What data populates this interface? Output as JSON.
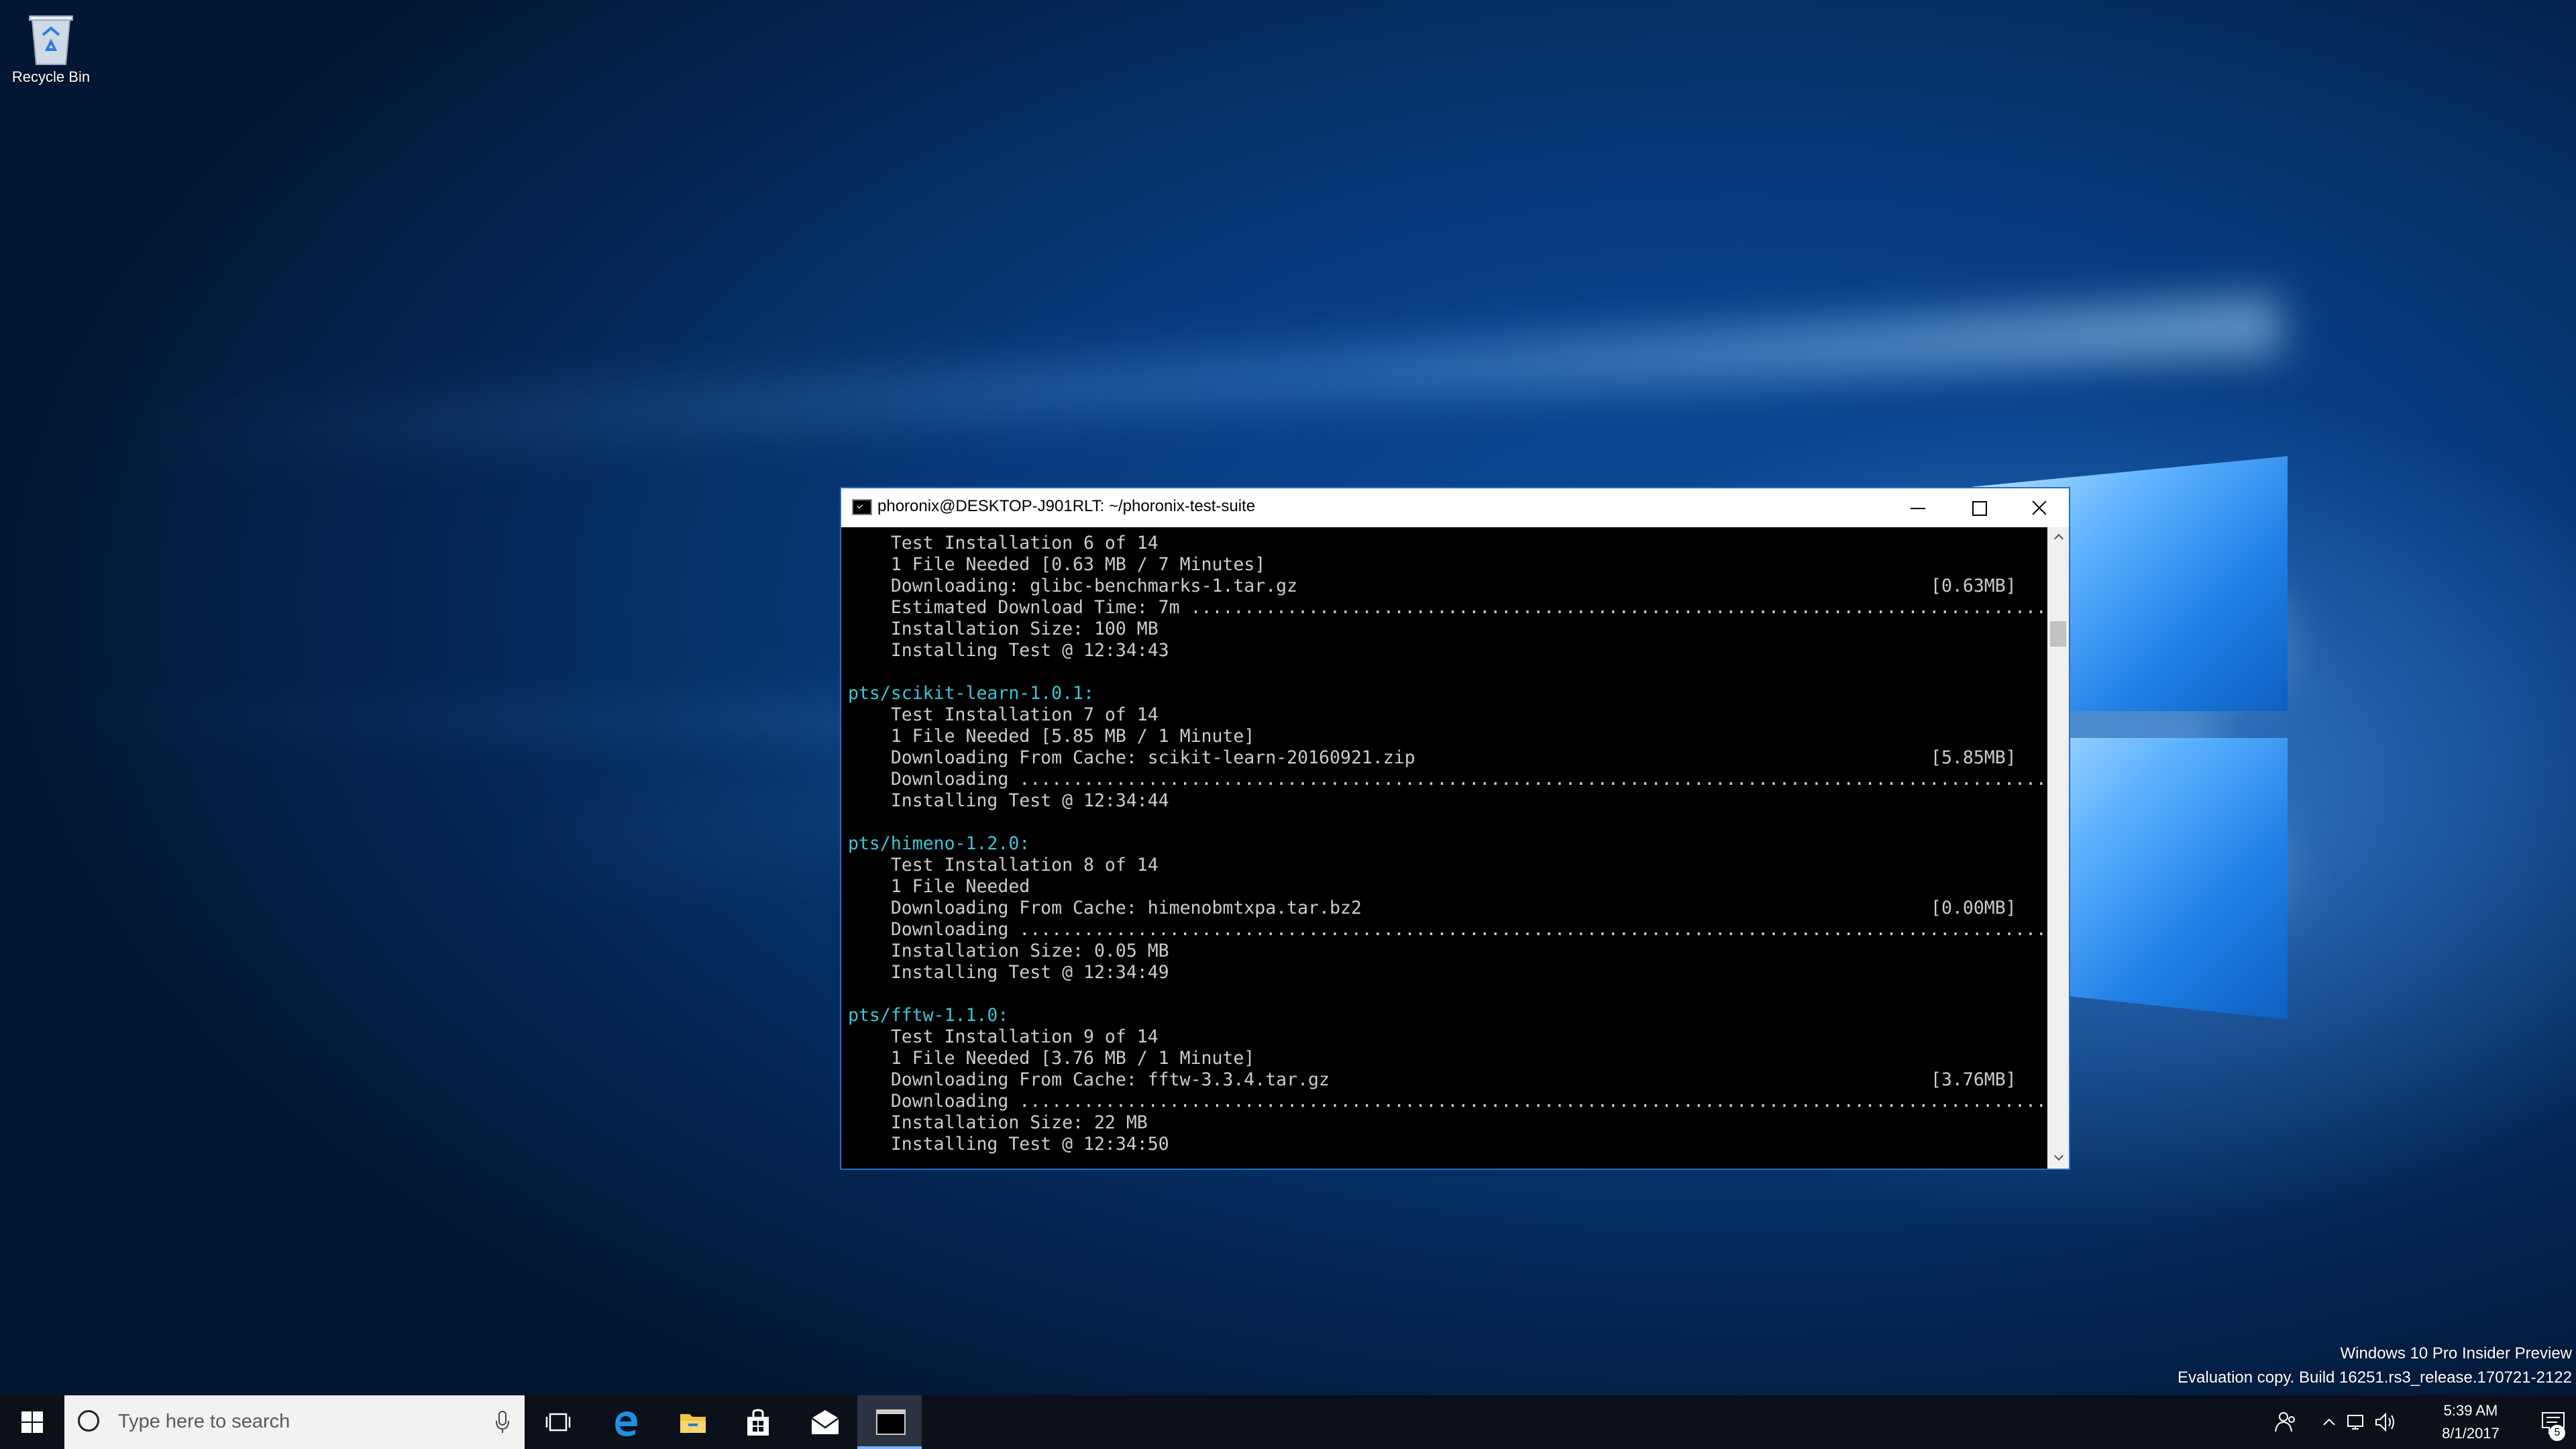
{
  "desktop": {
    "icons": [
      {
        "label": "Recycle Bin",
        "icon": "recycle-bin-icon"
      }
    ],
    "watermark": {
      "line1": "Windows 10 Pro Insider Preview",
      "line2": "Evaluation copy. Build 16251.rs3_release.170721-2122"
    }
  },
  "terminal": {
    "title": "phoronix@DESKTOP-J901RLT: ~/phoronix-test-suite",
    "lines": [
      {
        "text": "    Test Installation 6 of 14",
        "right": ""
      },
      {
        "text": "    1 File Needed [0.63 MB / 7 Minutes]",
        "right": ""
      },
      {
        "text": "    Downloading: glibc-benchmarks-1.tar.gz",
        "right": "[0.63MB]"
      },
      {
        "text": "    Estimated Download Time: 7m ................................................................................",
        "right": ""
      },
      {
        "text": "    Installation Size: 100 MB",
        "right": ""
      },
      {
        "text": "    Installing Test @ 12:34:43",
        "right": ""
      },
      {
        "text": "",
        "right": ""
      },
      {
        "text": "pts/scikit-learn-1.0.1:",
        "right": "",
        "pkg": true
      },
      {
        "text": "    Test Installation 7 of 14",
        "right": ""
      },
      {
        "text": "    1 File Needed [5.85 MB / 1 Minute]",
        "right": ""
      },
      {
        "text": "    Downloading From Cache: scikit-learn-20160921.zip",
        "right": "[5.85MB]"
      },
      {
        "text": "    Downloading ................................................................................................",
        "right": ""
      },
      {
        "text": "    Installing Test @ 12:34:44",
        "right": ""
      },
      {
        "text": "",
        "right": ""
      },
      {
        "text": "pts/himeno-1.2.0:",
        "right": "",
        "pkg": true
      },
      {
        "text": "    Test Installation 8 of 14",
        "right": ""
      },
      {
        "text": "    1 File Needed",
        "right": ""
      },
      {
        "text": "    Downloading From Cache: himenobmtxpa.tar.bz2",
        "right": "[0.00MB]"
      },
      {
        "text": "    Downloading ................................................................................................",
        "right": ""
      },
      {
        "text": "    Installation Size: 0.05 MB",
        "right": ""
      },
      {
        "text": "    Installing Test @ 12:34:49",
        "right": ""
      },
      {
        "text": "",
        "right": ""
      },
      {
        "text": "pts/fftw-1.1.0:",
        "right": "",
        "pkg": true
      },
      {
        "text": "    Test Installation 9 of 14",
        "right": ""
      },
      {
        "text": "    1 File Needed [3.76 MB / 1 Minute]",
        "right": ""
      },
      {
        "text": "    Downloading From Cache: fftw-3.3.4.tar.gz",
        "right": "[3.76MB]"
      },
      {
        "text": "    Downloading ................................................................................................",
        "right": ""
      },
      {
        "text": "    Installation Size: 22 MB",
        "right": ""
      },
      {
        "text": "    Installing Test @ 12:34:50",
        "right": ""
      }
    ]
  },
  "taskbar": {
    "search_placeholder": "Type here to search",
    "pinned": [
      {
        "name": "task-view-button",
        "icon": "task-view-icon"
      },
      {
        "name": "edge-button",
        "icon": "edge-icon"
      },
      {
        "name": "file-explorer-button",
        "icon": "folder-icon"
      },
      {
        "name": "store-button",
        "icon": "store-icon"
      },
      {
        "name": "mail-button",
        "icon": "mail-icon"
      },
      {
        "name": "terminal-button",
        "icon": "terminal-icon",
        "active": true
      }
    ],
    "clock": {
      "time": "5:39 AM",
      "date": "8/1/2017"
    },
    "notification_count": "5"
  }
}
